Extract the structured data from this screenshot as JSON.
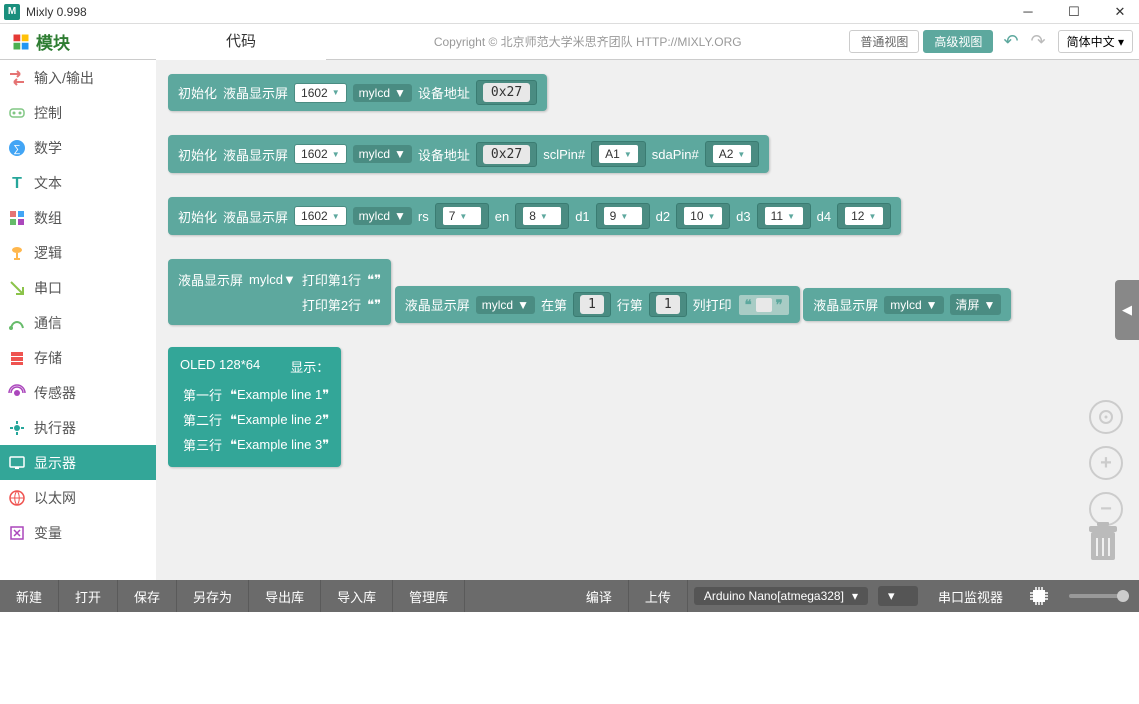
{
  "window": {
    "title": "Mixly 0.998"
  },
  "topbar": {
    "modules_label": "模块",
    "code_tab": "代码",
    "credit": "Copyright  ©  北京师范大学米思齐团队  HTTP://MIXLY.ORG",
    "normal_view": "普通视图",
    "advanced_view": "高级视图",
    "lang": "简体中文"
  },
  "categories": [
    {
      "label": "输入/输出",
      "id": "io"
    },
    {
      "label": "控制",
      "id": "control"
    },
    {
      "label": "数学",
      "id": "math"
    },
    {
      "label": "文本",
      "id": "text"
    },
    {
      "label": "数组",
      "id": "array"
    },
    {
      "label": "逻辑",
      "id": "logic"
    },
    {
      "label": "串口",
      "id": "serial"
    },
    {
      "label": "通信",
      "id": "comm"
    },
    {
      "label": "存储",
      "id": "storage"
    },
    {
      "label": "传感器",
      "id": "sensor"
    },
    {
      "label": "执行器",
      "id": "actuator"
    },
    {
      "label": "显示器",
      "id": "display"
    },
    {
      "label": "以太网",
      "id": "ethernet"
    },
    {
      "label": "变量",
      "id": "variable"
    }
  ],
  "blocks": {
    "b1": {
      "l1": "初始化",
      "l2": "液晶显示屏",
      "type": "1602",
      "name": "mylcd",
      "addr_lbl": "设备地址",
      "addr": "0x27"
    },
    "b2": {
      "l1": "初始化",
      "l2": "液晶显示屏",
      "type": "1602",
      "name": "mylcd",
      "addr_lbl": "设备地址",
      "addr": "0x27",
      "scl": "sclPin#",
      "scl_v": "A1",
      "sda": "sdaPin#",
      "sda_v": "A2"
    },
    "b3": {
      "l1": "初始化",
      "l2": "液晶显示屏",
      "type": "1602",
      "name": "mylcd",
      "rs": "rs",
      "rs_v": "7",
      "en": "en",
      "en_v": "8",
      "d1": "d1",
      "d1_v": "9",
      "d2": "d2",
      "d2_v": "10",
      "d3": "d3",
      "d3_v": "11",
      "d4": "d4",
      "d4_v": "12"
    },
    "b4": {
      "lcd": "液晶显示屏",
      "name": "mylcd",
      "r1": "打印第1行",
      "r2": "打印第2行"
    },
    "b5": {
      "lcd": "液晶显示屏",
      "name": "mylcd",
      "at": "在第",
      "row": "1",
      "col_lbl": "行第",
      "col": "1",
      "print": "列打印"
    },
    "b6": {
      "lcd": "液晶显示屏",
      "name": "mylcd",
      "clear": "清屏"
    },
    "b7": {
      "title": "OLED 128*64",
      "show": "显示：",
      "r1": "第一行",
      "r2": "第二行",
      "r3": "第三行",
      "v1": "Example line 1",
      "v2": "Example line 2",
      "v3": "Example line 3"
    }
  },
  "bottombar": {
    "new": "新建",
    "open": "打开",
    "save": "保存",
    "saveas": "另存为",
    "export": "导出库",
    "import": "导入库",
    "manage": "管理库",
    "compile": "编译",
    "upload": "上传",
    "board": "Arduino Nano[atmega328]",
    "monitor": "串口监视器"
  }
}
